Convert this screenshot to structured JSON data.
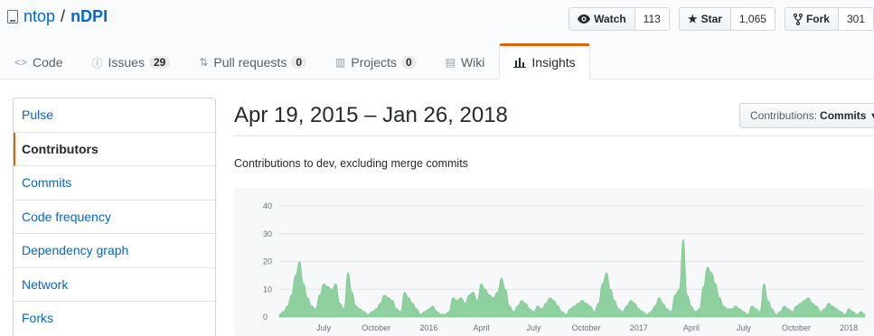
{
  "repo": {
    "owner": "ntop",
    "separator": "/",
    "name": "nDPI"
  },
  "actions": {
    "watch": {
      "label": "Watch",
      "count": "113",
      "icon": "eye-icon"
    },
    "star": {
      "label": "Star",
      "count": "1,065",
      "icon": "star-icon"
    },
    "fork": {
      "label": "Fork",
      "count": "301",
      "icon": "fork-icon"
    }
  },
  "nav": {
    "code": {
      "label": "Code",
      "icon": "code-icon"
    },
    "issues": {
      "label": "Issues",
      "count": "29",
      "icon": "issue-icon"
    },
    "pulls": {
      "label": "Pull requests",
      "count": "0",
      "icon": "pull-request-icon"
    },
    "projects": {
      "label": "Projects",
      "count": "0",
      "icon": "project-icon"
    },
    "wiki": {
      "label": "Wiki",
      "icon": "book-icon"
    },
    "insights": {
      "label": "Insights",
      "icon": "graph-icon"
    }
  },
  "sidebar": {
    "items": [
      {
        "label": "Pulse",
        "selected": false
      },
      {
        "label": "Contributors",
        "selected": true
      },
      {
        "label": "Commits",
        "selected": false
      },
      {
        "label": "Code frequency",
        "selected": false
      },
      {
        "label": "Dependency graph",
        "selected": false
      },
      {
        "label": "Network",
        "selected": false
      },
      {
        "label": "Forks",
        "selected": false
      }
    ]
  },
  "main": {
    "heading": "Apr 19, 2015 – Jan 26, 2018",
    "select_prefix": "Contributions:",
    "select_value": "Commits",
    "description": "Contributions to dev, excluding merge commits"
  },
  "colors": {
    "accent": "#e36209",
    "link": "#0366d6",
    "area_fill": "#8fd19e",
    "area_stroke": "#6cc086"
  },
  "chart_data": {
    "type": "area",
    "title": "",
    "xlabel": "",
    "ylabel": "",
    "ylim": [
      0,
      40
    ],
    "yticks": [
      0,
      10,
      20,
      30,
      40
    ],
    "xticks": [
      {
        "label": "July",
        "week": 11
      },
      {
        "label": "October",
        "week": 24
      },
      {
        "label": "2016",
        "week": 37
      },
      {
        "label": "April",
        "week": 50
      },
      {
        "label": "July",
        "week": 63
      },
      {
        "label": "October",
        "week": 76
      },
      {
        "label": "2017",
        "week": 89
      },
      {
        "label": "April",
        "week": 102
      },
      {
        "label": "July",
        "week": 115
      },
      {
        "label": "October",
        "week": 128
      },
      {
        "label": "2018",
        "week": 141
      }
    ],
    "grid": true,
    "series": [
      {
        "values": [
          1,
          2,
          4,
          8,
          15,
          20,
          12,
          7,
          4,
          3,
          8,
          12,
          11,
          10,
          12,
          5,
          3,
          16,
          9,
          4,
          3,
          2,
          1,
          2,
          3,
          5,
          8,
          7,
          6,
          3,
          2,
          9,
          7,
          5,
          3,
          1,
          2,
          3,
          4,
          2,
          1,
          1,
          2,
          7,
          6,
          7,
          5,
          8,
          9,
          6,
          12,
          10,
          8,
          7,
          9,
          14,
          10,
          4,
          2,
          4,
          6,
          5,
          3,
          2,
          4,
          3,
          5,
          7,
          6,
          4,
          2,
          1,
          3,
          4,
          5,
          6,
          5,
          4,
          2,
          5,
          12,
          16,
          10,
          6,
          3,
          2,
          4,
          6,
          5,
          3,
          2,
          1,
          2,
          4,
          7,
          5,
          3,
          2,
          8,
          10,
          28,
          8,
          4,
          2,
          3,
          11,
          18,
          16,
          12,
          7,
          4,
          3,
          3,
          4,
          3,
          2,
          1,
          4,
          3,
          2,
          12,
          6,
          3,
          1,
          2,
          4,
          3,
          2,
          4,
          5,
          6,
          7,
          5,
          4,
          2,
          3,
          5,
          4,
          3,
          2,
          1,
          3,
          2,
          1,
          2,
          1
        ]
      }
    ]
  }
}
